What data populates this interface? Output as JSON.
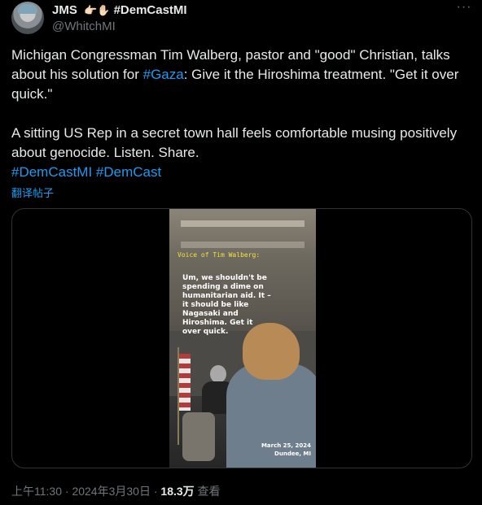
{
  "author": {
    "display_name": "JMS",
    "badges": "👉🏻✋🏻",
    "hashtag": "#DemCastMI",
    "handle": "@WhitchMI"
  },
  "tweet": {
    "para1_before": "Michigan Congressman Tim Walberg, pastor and \"good\" Christian, talks about his solution for ",
    "para1_link": "#Gaza",
    "para1_after": ": Give it the Hiroshima treatment. \"Get it over quick.\"",
    "para2": "A sitting US Rep in a secret town hall feels comfortable musing positively about genocide. Listen. Share.",
    "tag1": "#DemCastMI",
    "tag2": "#DemCast"
  },
  "translate_label": "翻译帖子",
  "video": {
    "title": "Voice of Tim Walberg:",
    "quote": "Um, we shouldn't be spending a dime on humanitarian aid. It – it should be like Nagasaki and Hiroshima. Get it over quick.",
    "date": "March 25, 2024",
    "place": "Dundee, MI"
  },
  "meta": {
    "time": "上午11:30",
    "sep1": " · ",
    "date": "2024年3月30日",
    "sep2": " · ",
    "views_count": "18.3万",
    "views_label": " 查看"
  },
  "icons": {
    "more": "more-options-icon"
  },
  "colors": {
    "background": "#000000",
    "text": "#e7e9ea",
    "muted": "#71767b",
    "link": "#1d9bf0"
  }
}
